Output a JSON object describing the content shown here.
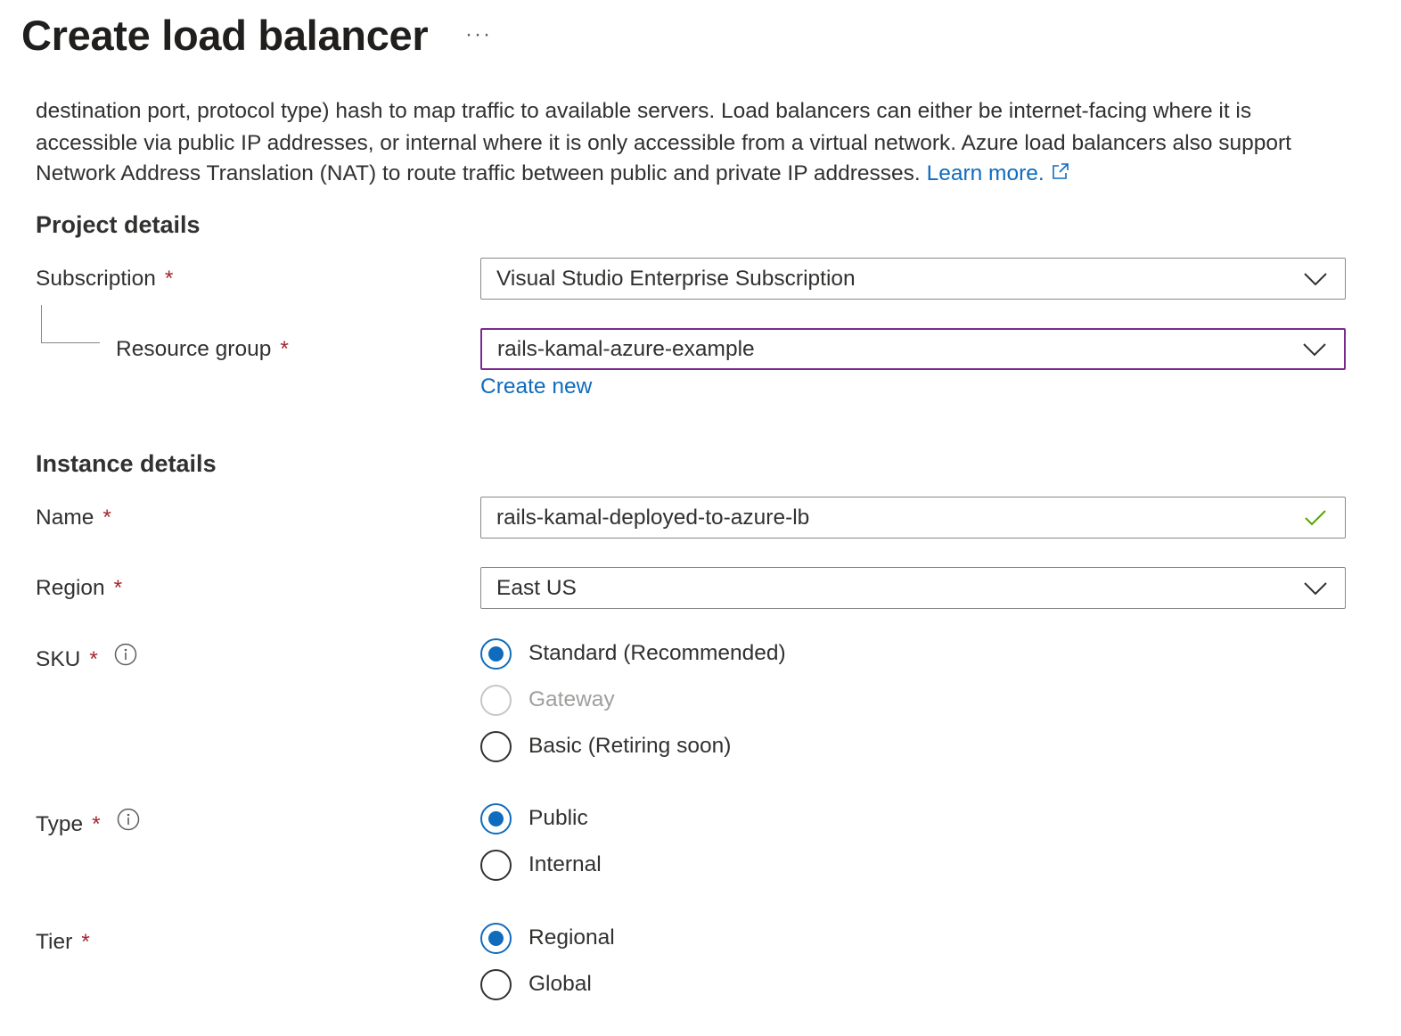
{
  "header": {
    "title": "Create load balancer",
    "more_label": "···"
  },
  "description": {
    "line1": "destination port, protocol type) hash to map traffic to available servers. Load balancers can either be internet-facing where it is",
    "line2": "accessible via public IP addresses, or internal where it is only accessible from a virtual network. Azure load balancers also support",
    "line3": "Network Address Translation (NAT) to route traffic between public and private IP addresses.",
    "learn_more": "Learn more."
  },
  "project_details": {
    "heading": "Project details",
    "subscription": {
      "label": "Subscription",
      "required_mark": "*",
      "value": "Visual Studio Enterprise Subscription"
    },
    "resource_group": {
      "label": "Resource group",
      "required_mark": "*",
      "value": "rails-kamal-azure-example",
      "create_new": "Create new"
    }
  },
  "instance_details": {
    "heading": "Instance details",
    "name": {
      "label": "Name",
      "required_mark": "*",
      "value": "rails-kamal-deployed-to-azure-lb",
      "valid": true
    },
    "region": {
      "label": "Region",
      "required_mark": "*",
      "value": "East US"
    },
    "sku": {
      "label": "SKU",
      "required_mark": "*",
      "options": [
        {
          "label": "Standard (Recommended)",
          "checked": true,
          "disabled": false
        },
        {
          "label": "Gateway",
          "checked": false,
          "disabled": true
        },
        {
          "label": "Basic (Retiring soon)",
          "checked": false,
          "disabled": false
        }
      ]
    },
    "type": {
      "label": "Type",
      "required_mark": "*",
      "options": [
        {
          "label": "Public",
          "checked": true
        },
        {
          "label": "Internal",
          "checked": false
        }
      ]
    },
    "tier": {
      "label": "Tier",
      "required_mark": "*",
      "options": [
        {
          "label": "Regional",
          "checked": true
        },
        {
          "label": "Global",
          "checked": false
        }
      ]
    }
  },
  "colors": {
    "accent": "#0f6cbd",
    "required": "#a4262c",
    "focus_border": "#7a2a8f",
    "valid_check": "#57a300",
    "text": "#323130"
  },
  "icons": {
    "more": "ellipsis-icon",
    "external_link": "external-link-icon",
    "dropdown": "chevron-down-icon",
    "valid": "checkmark-icon",
    "info": "info-icon"
  }
}
